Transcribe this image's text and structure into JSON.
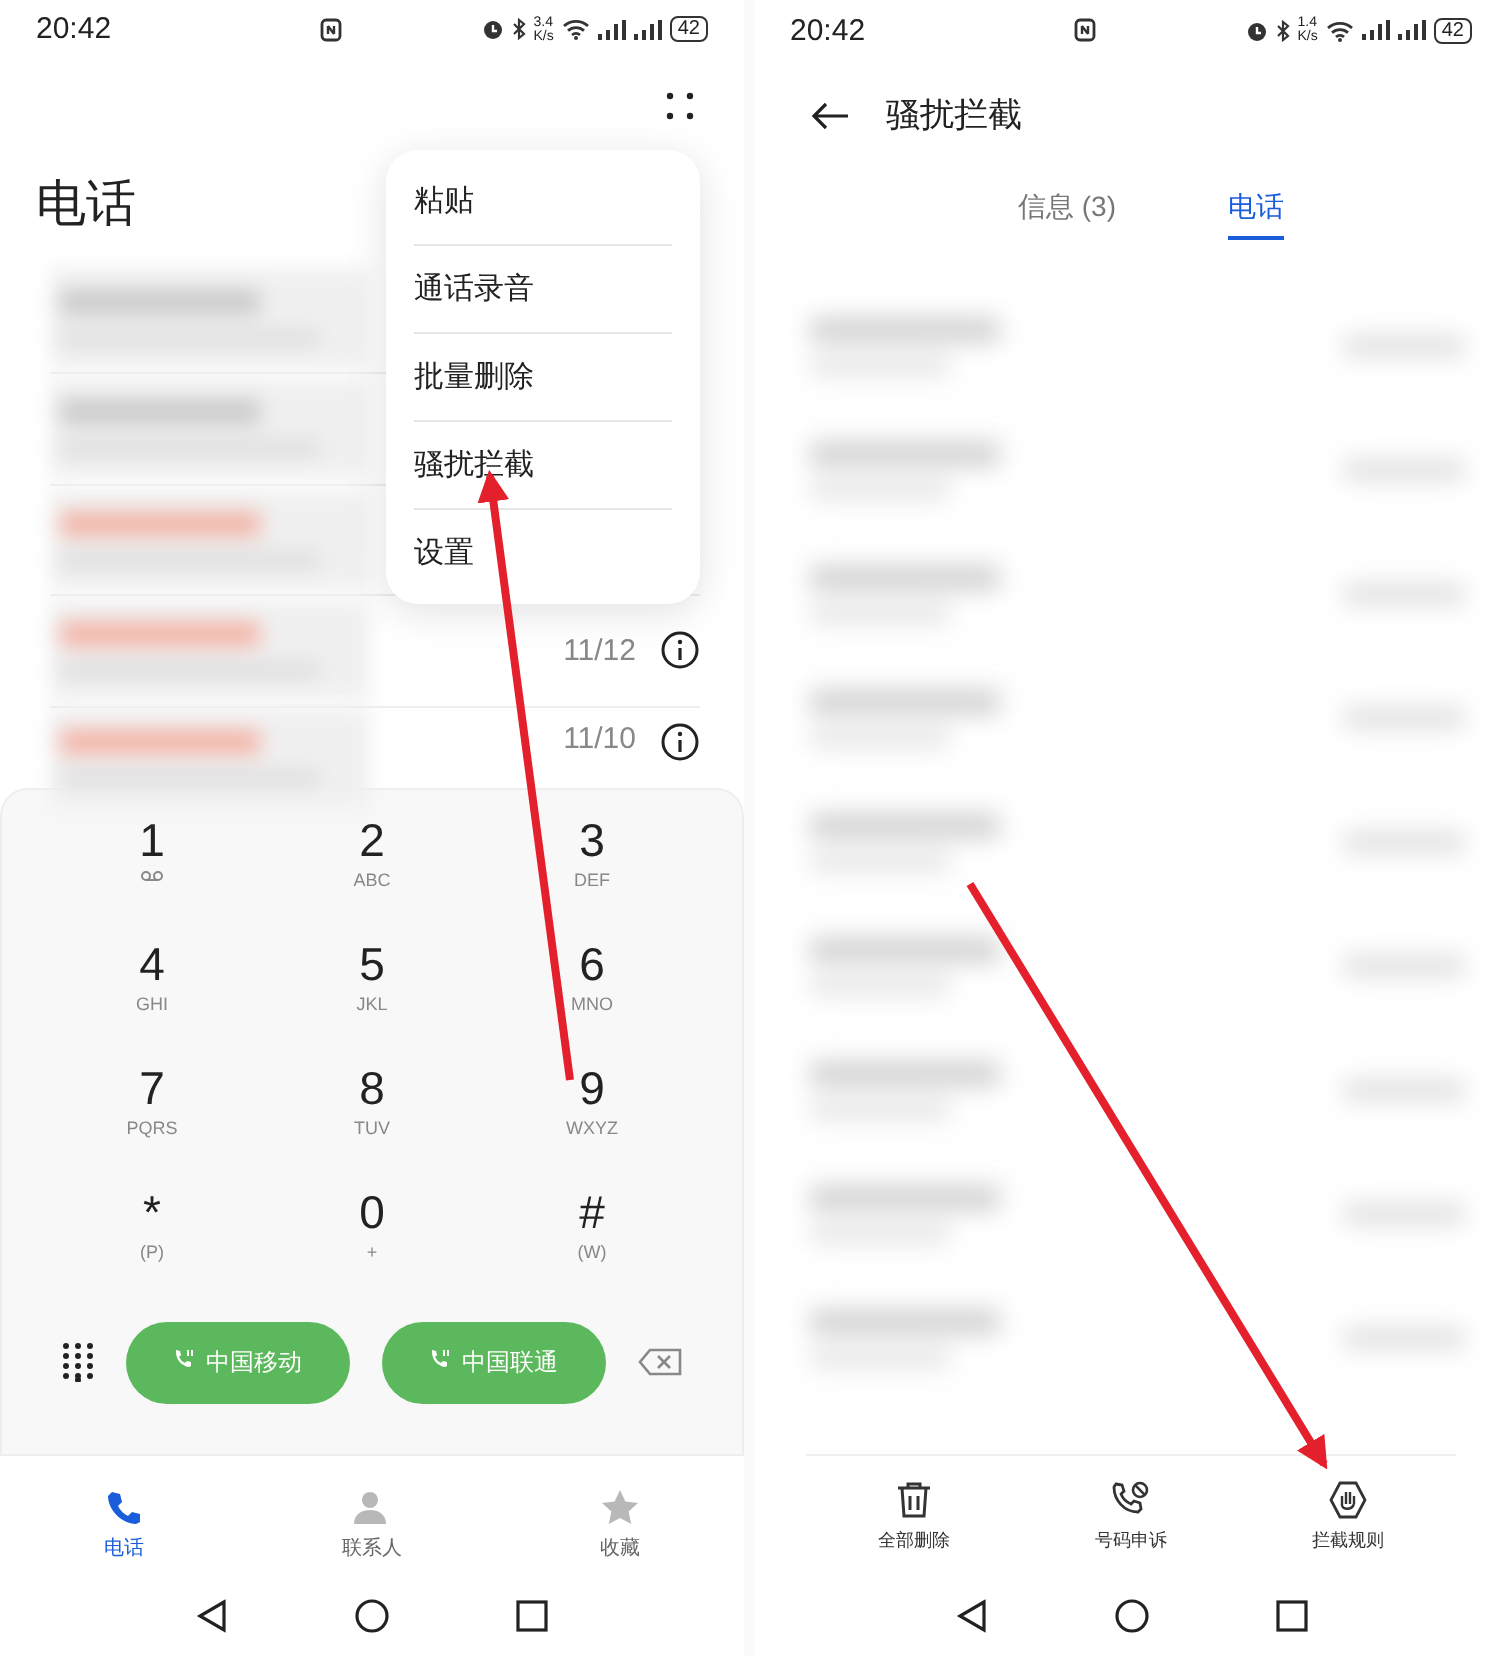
{
  "left_screen": {
    "status_bar": {
      "time": "20:42",
      "speed_value": "3.4",
      "speed_unit": "K/s",
      "battery": "42"
    },
    "title": "电话",
    "call_log": [
      {
        "missed": false
      },
      {
        "missed": false
      },
      {
        "missed": true
      },
      {
        "missed": true,
        "date": "11/12"
      },
      {
        "missed": true,
        "date": "11/10"
      }
    ],
    "menu": {
      "items": [
        "粘贴",
        "通话录音",
        "批量删除",
        "骚扰拦截",
        "设置"
      ]
    },
    "dialpad": {
      "keys": [
        {
          "digit": "1",
          "kind": "voicemail"
        },
        {
          "digit": "2",
          "letters": "ABC",
          "kind": "plain"
        },
        {
          "digit": "3",
          "letters": "DEF",
          "kind": "plain"
        },
        {
          "digit": "4",
          "letters": "GHI",
          "kind": "plain"
        },
        {
          "digit": "5",
          "letters": "JKL",
          "kind": "plain"
        },
        {
          "digit": "6",
          "letters": "MNO",
          "kind": "plain"
        },
        {
          "digit": "7",
          "letters": "PQRS",
          "kind": "plain"
        },
        {
          "digit": "8",
          "letters": "TUV",
          "kind": "plain"
        },
        {
          "digit": "9",
          "letters": "WXYZ",
          "kind": "plain"
        },
        {
          "digit": "*",
          "letters": "(P)",
          "kind": "plain"
        },
        {
          "digit": "0",
          "letters": "+",
          "kind": "plain"
        },
        {
          "digit": "#",
          "letters": "(W)",
          "kind": "plain"
        }
      ],
      "sim_buttons": [
        "中国移动",
        "中国联通"
      ]
    },
    "bottom_tabs": [
      {
        "label": "电话",
        "kind": "phone",
        "selected": true
      },
      {
        "label": "联系人",
        "kind": "contacts",
        "selected": false
      },
      {
        "label": "收藏",
        "kind": "favorites",
        "selected": false
      }
    ]
  },
  "right_screen": {
    "status_bar": {
      "time": "20:42",
      "speed_value": "1.4",
      "speed_unit": "K/s",
      "battery": "42"
    },
    "title": "骚扰拦截",
    "tabs": [
      {
        "label": "信息 (3)",
        "selected": false
      },
      {
        "label": "电话",
        "selected": true
      }
    ],
    "toolbar": [
      {
        "label": "全部删除",
        "kind": "delete"
      },
      {
        "label": "号码申诉",
        "kind": "appeal"
      },
      {
        "label": "拦截规则",
        "kind": "rules"
      }
    ]
  }
}
